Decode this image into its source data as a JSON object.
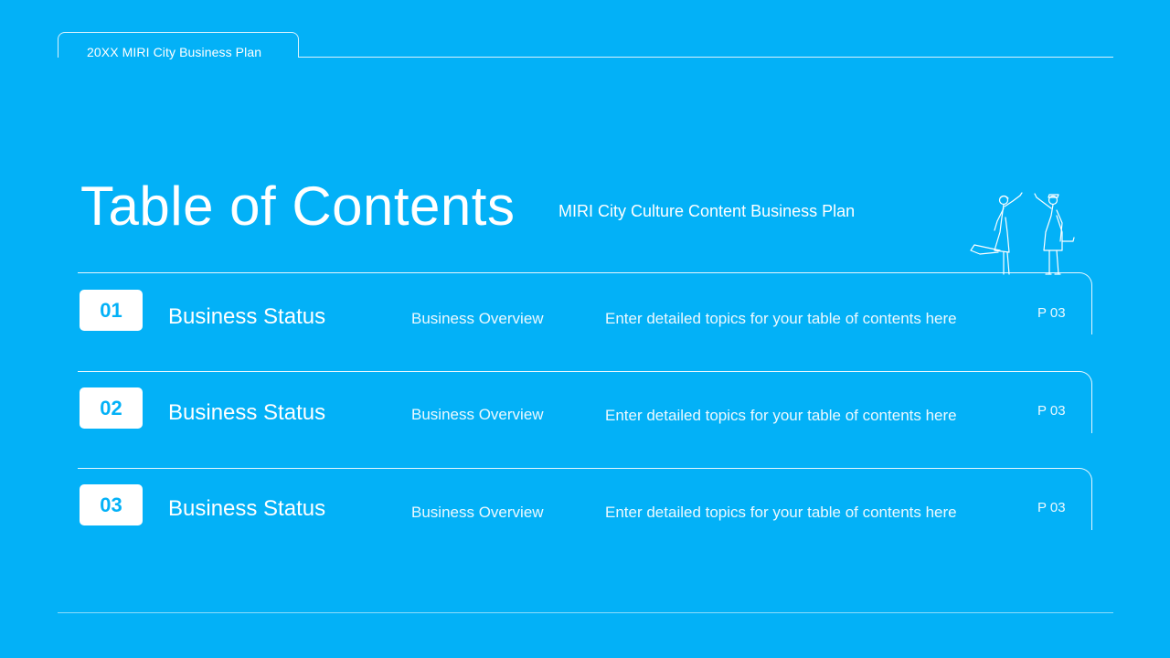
{
  "header": {
    "label": "20XX MIRI City Business Plan"
  },
  "title": "Table of Contents",
  "subtitle": "MIRI City Culture Content Business Plan",
  "illustration_icon": "two-people-high-five-line-illustration",
  "colors": {
    "background": "#03b1f7",
    "foreground": "#ffffff"
  },
  "toc": [
    {
      "number": "01",
      "title": "Business Status",
      "section": "Business Overview",
      "detail": "Enter detailed topics for your table of contents here",
      "page": "P 03"
    },
    {
      "number": "02",
      "title": "Business Status",
      "section": "Business Overview",
      "detail": "Enter detailed topics for your table of contents here",
      "page": "P 03"
    },
    {
      "number": "03",
      "title": "Business Status",
      "section": "Business Overview",
      "detail": "Enter detailed topics for your table of contents here",
      "page": "P 03"
    }
  ]
}
